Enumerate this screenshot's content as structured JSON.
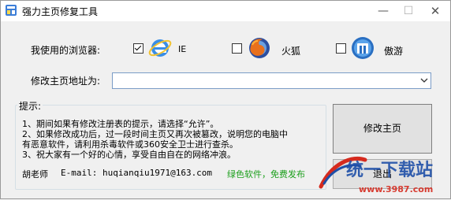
{
  "window": {
    "title": "强力主页修复工具",
    "min_symbol": "—",
    "max_symbol": "☐",
    "close_symbol": "✕"
  },
  "browser_row": {
    "label": "我使用的浏览器:",
    "options": [
      {
        "label": "IE",
        "checked": true,
        "icon": "ie-icon"
      },
      {
        "label": "火狐",
        "checked": false,
        "icon": "firefox-icon"
      },
      {
        "label": "傲游",
        "checked": false,
        "icon": "maxthon-icon"
      }
    ]
  },
  "homepage": {
    "label": "修改主页地址为:",
    "value": ""
  },
  "tips": {
    "title": "提示:",
    "lines": [
      "1、期间如果有修改注册表的提示，请选择“允许”。",
      "2、如果修改成功后，过一段时间主页又再次被篡改，说明您的电脑中",
      "有恶意软件，请利用杀毒软件或360安全卫士进行查杀。",
      "3、祝大家有一个好的心情，享受自由自在的网络冲浪。"
    ]
  },
  "footer": {
    "author": "胡老师",
    "email": "E-mail: huqianqiu1971@163.com",
    "slogan": "绿色软件，免费发布"
  },
  "buttons": {
    "modify": "修改主页",
    "exit": "退出"
  },
  "watermark": {
    "brand": "统一下载站",
    "domain": "www.3987.com"
  },
  "colors": {
    "accent_blue": "#2f6fb5",
    "slogan_green": "#1a9e1a",
    "watermark_blue": "#1f4fa8",
    "watermark_red": "#d52a1e"
  }
}
